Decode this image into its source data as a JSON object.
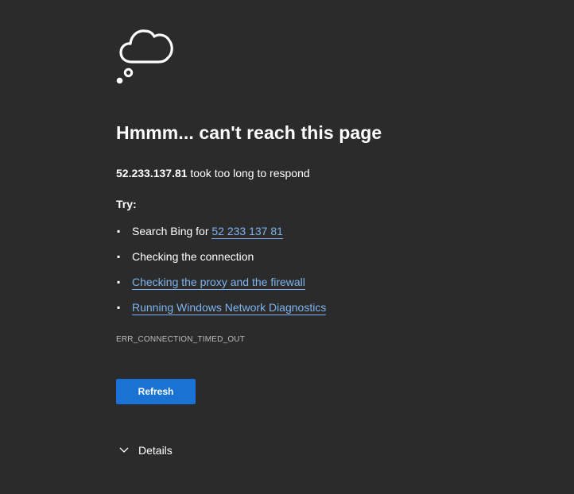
{
  "error": {
    "title": "Hmmm... can't reach this page",
    "host": "52.233.137.81",
    "message": " took too long to respond",
    "try_label": "Try:",
    "suggestions": [
      {
        "prefix": "Search Bing for ",
        "link": "52 233 137 81"
      },
      {
        "text": "Checking the connection"
      },
      {
        "link": "Checking the proxy and the firewall"
      },
      {
        "link": "Running Windows Network Diagnostics"
      }
    ],
    "code": "ERR_CONNECTION_TIMED_OUT"
  },
  "actions": {
    "refresh_label": "Refresh",
    "details_label": "Details"
  },
  "theme": {
    "background": "#2b2b2b",
    "link_color": "#7eb4f0",
    "button_color": "#1a73d4"
  },
  "icons": {
    "main": "thought-cloud-icon",
    "details": "chevron-down-icon"
  }
}
